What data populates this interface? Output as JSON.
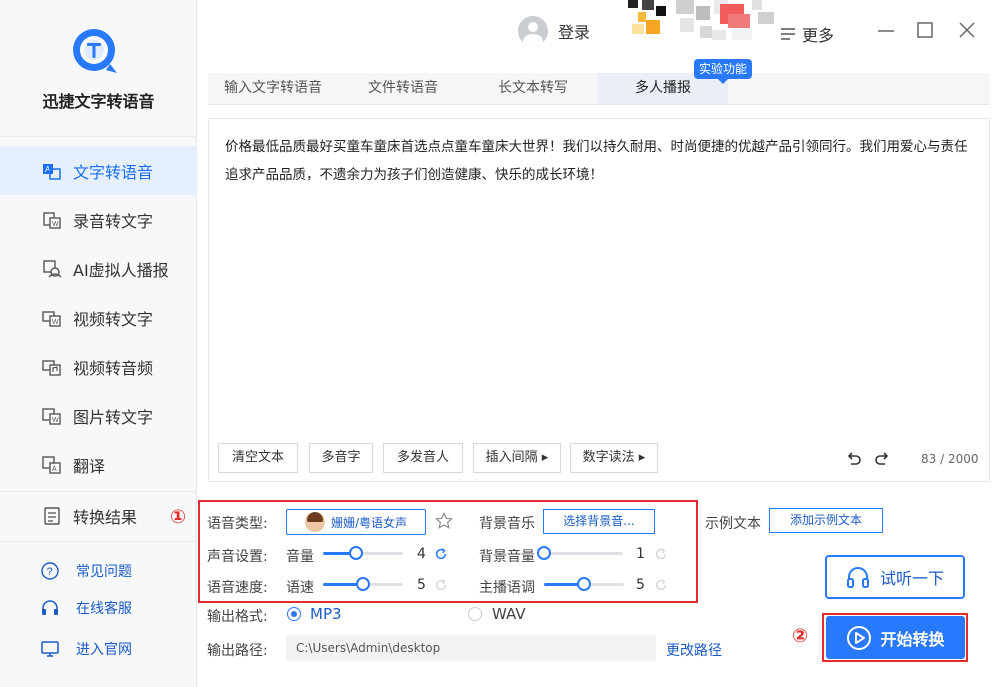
{
  "app": {
    "title": "迅捷文字转语音"
  },
  "sidebar": {
    "items": [
      {
        "label": "文字转语音",
        "icon": "text-to-speech-icon",
        "active": true
      },
      {
        "label": "录音转文字",
        "icon": "recording-to-text-icon"
      },
      {
        "label": "AI虚拟人播报",
        "icon": "ai-avatar-icon"
      },
      {
        "label": "视频转文字",
        "icon": "video-to-text-icon"
      },
      {
        "label": "视频转音频",
        "icon": "video-to-audio-icon"
      },
      {
        "label": "图片转文字",
        "icon": "image-to-text-icon"
      },
      {
        "label": "翻译",
        "icon": "translate-icon"
      },
      {
        "label": "转换结果",
        "icon": "results-icon"
      }
    ],
    "links": [
      {
        "label": "常见问题",
        "icon": "question-icon"
      },
      {
        "label": "在线客服",
        "icon": "headset-icon"
      },
      {
        "label": "进入官网",
        "icon": "monitor-icon"
      }
    ]
  },
  "topbar": {
    "login": "登录",
    "more": "更多"
  },
  "tabs": [
    {
      "label": "输入文字转语音"
    },
    {
      "label": "文件转语音"
    },
    {
      "label": "长文本转写"
    },
    {
      "label": "多人播报",
      "active": true
    }
  ],
  "badge": "实验功能",
  "editor": {
    "text": "价格最低品质最好买童车童床首选点点童车童床大世界！我们以持久耐用、时尚便捷的优越产品引领同行。我们用爱心与责任追求产品品质，不遗余力为孩子们创造健康、快乐的成长环境！",
    "count": "83 / 2000",
    "buttons": [
      "清空文本",
      "多音字",
      "多发音人",
      "插入间隔 ▸",
      "数字读法 ▸"
    ]
  },
  "settings": {
    "voice_type_label": "语音类型:",
    "voice_name": "姗姗/粤语女声",
    "bg_music_label": "背景音乐",
    "bg_music_button": "选择背景音...",
    "sample_text_label": "示例文本",
    "sample_text_button": "添加示例文本",
    "sound_label": "声音设置:",
    "volume_label": "音量",
    "volume_value": "4",
    "bg_volume_label": "背景音量",
    "bg_volume_value": "1",
    "speed_label": "语音速度:",
    "rate_label": "语速",
    "rate_value": "5",
    "tone_label": "主播语调",
    "tone_value": "5",
    "levels": {
      "volume": 0.4,
      "bg_volume": 0.0,
      "rate": 0.5,
      "tone": 0.5
    }
  },
  "output": {
    "format_label": "输出格式:",
    "formats": [
      "MP3",
      "WAV"
    ],
    "selected": "MP3",
    "path_label": "输出路径:",
    "path": "C:\\Users\\Admin\\desktop",
    "change_path": "更改路径"
  },
  "actions": {
    "listen": "试听一下",
    "start": "开始转换"
  },
  "annotations": {
    "one": "①",
    "two": "②"
  },
  "colors": {
    "accent": "#2979ff",
    "highlight": "#e52b2b"
  }
}
